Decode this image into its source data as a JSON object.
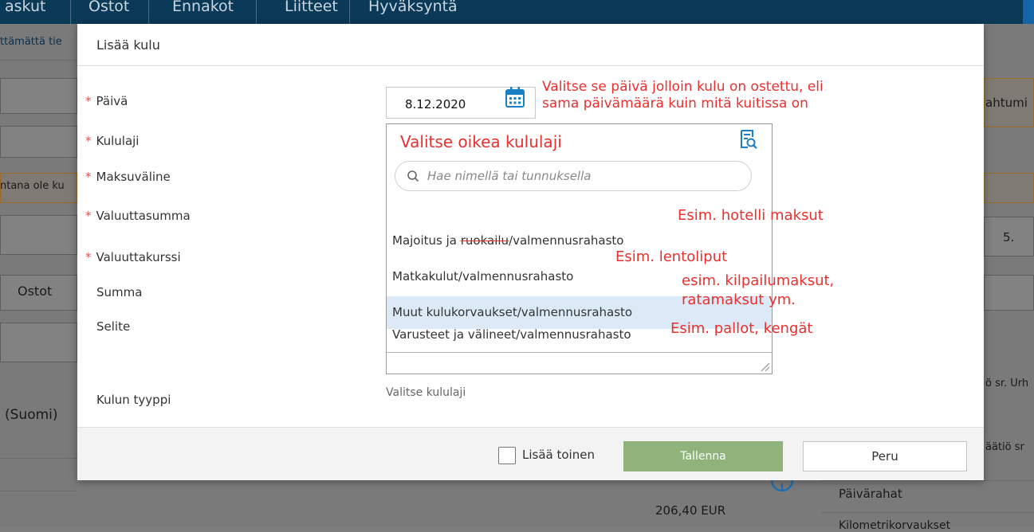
{
  "background": {
    "nav_tabs": [
      "askut",
      "Ostot",
      "Ennakot",
      "Liitteet",
      "Hyväksyntä"
    ],
    "left_texts": [
      "ttämättä tie",
      "ntana ole ku",
      "Ostot",
      "(Suomi)"
    ],
    "right_texts": [
      "ahtumi",
      "5.",
      "ö sr. Urh",
      "äätiö sr",
      "Päivärahat",
      "Kilometrikorvaukset"
    ],
    "amount": "206,40 EUR"
  },
  "modal": {
    "title": "Lisää kulu",
    "fields": {
      "paiva": "Päivä",
      "kululaji": "Kululaji",
      "maksuvaline": "Maksuväline",
      "valuuttasumma": "Valuuttasumma",
      "valuuttakurssi": "Valuuttakurssi",
      "summa": "Summa",
      "selite": "Selite",
      "kulun_tyyppi": "Kulun tyyppi"
    },
    "required_mark": "*",
    "date_value": "8.12.2020",
    "dropdown": {
      "search_placeholder": "Hae nimellä tai tunnuksella",
      "options": [
        {
          "prefix": "Majoitus ja ",
          "struck": "ruokailu",
          "suffix": "/valmennusrahasto"
        },
        {
          "label": "Matkakulut/valmennusrahasto"
        },
        {
          "label": "Muut kulukorvaukset/valmennusrahasto",
          "highlighted": true
        },
        {
          "label": "Varusteet ja välineet/valmennusrahasto"
        }
      ]
    },
    "kulun_tyyppi_hint": "Valitse kululaji",
    "footer": {
      "add_another_label": "Lisää toinen",
      "add_another_checked": false,
      "save_label": "Tallenna",
      "cancel_label": "Peru"
    }
  },
  "annotations": {
    "date_line1": "Valitse se päivä jolloin kulu on ostettu, eli",
    "date_line2": "sama päivämäärä kuin mitä kuitissa on",
    "kululaji": "Valitse oikea kululaji",
    "opt1": "Esim. hotelli maksut",
    "opt2": "Esim. lentoliput",
    "opt3_line1": "esim. kilpailumaksut,",
    "opt3_line2": "ratamaksut ym.",
    "opt4": "Esim. pallot, kengät"
  },
  "colors": {
    "annotation": "#e8302f",
    "accent": "#1b7fc4",
    "save_button": "#8fb37b",
    "highlight": "#dbeaf6",
    "required": "#d9534f"
  },
  "icons": {
    "calendar": "calendar-icon",
    "browse": "list-search-icon",
    "search": "search-icon",
    "info": "info-icon"
  }
}
